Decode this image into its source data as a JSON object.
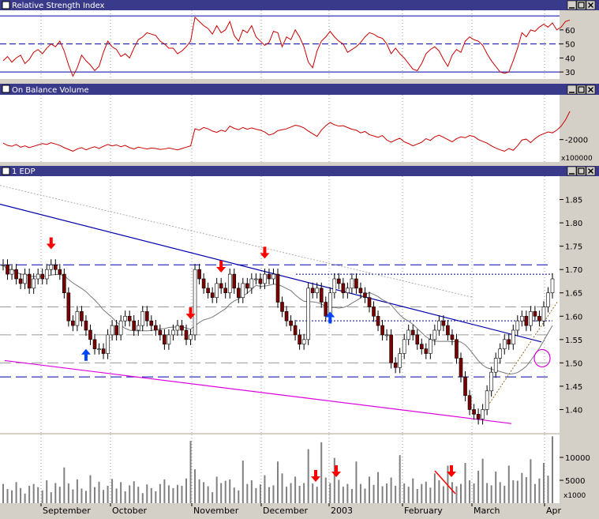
{
  "panels": {
    "rsi": {
      "title": "Relative Strength Index"
    },
    "obv": {
      "title": "On Balance Volume",
      "unit": "x100000"
    },
    "price": {
      "title": "1 EDP"
    },
    "volume": {
      "unit": "x1000"
    }
  },
  "months": [
    "September",
    "October",
    "November",
    "December",
    "2003",
    "February",
    "March",
    "Apr"
  ],
  "chart_data": [
    {
      "type": "line",
      "panel": "rsi",
      "title": "Relative Strength Index",
      "ylim": [
        25,
        74
      ],
      "yticks": [
        30,
        40,
        50,
        60
      ],
      "hlines": [
        30,
        50,
        70
      ],
      "values": [
        38,
        41,
        37,
        40,
        42,
        36,
        39,
        44,
        46,
        43,
        47,
        50,
        48,
        52,
        45,
        35,
        27,
        33,
        42,
        38,
        35,
        31,
        34,
        44,
        52,
        48,
        46,
        41,
        43,
        40,
        47,
        53,
        55,
        58,
        57,
        56,
        52,
        50,
        47,
        47,
        43,
        45,
        48,
        52,
        69,
        66,
        63,
        61,
        57,
        63,
        58,
        60,
        66,
        56,
        52,
        60,
        58,
        63,
        55,
        52,
        49,
        51,
        59,
        58,
        48,
        55,
        53,
        60,
        55,
        48,
        37,
        33,
        45,
        52,
        55,
        59,
        55,
        52,
        50,
        44,
        46,
        48,
        51,
        55,
        58,
        57,
        55,
        54,
        50,
        43,
        47,
        43,
        40,
        36,
        32,
        31,
        36,
        43,
        46,
        48,
        45,
        39,
        34,
        42,
        46,
        44,
        52,
        55,
        53,
        52,
        49,
        43,
        38,
        34,
        30,
        29,
        30,
        38,
        47,
        58,
        55,
        60,
        59,
        62,
        64,
        62,
        65,
        60,
        62,
        66,
        67
      ]
    },
    {
      "type": "line",
      "panel": "obv",
      "title": "On Balance Volume",
      "ylim": [
        -2500,
        -1000
      ],
      "yticks": [
        -2000
      ],
      "values": [
        -2080,
        -2130,
        -2150,
        -2110,
        -2170,
        -2140,
        -2180,
        -2150,
        -2120,
        -2090,
        -2110,
        -2070,
        -2100,
        -2130,
        -2180,
        -2220,
        -2260,
        -2210,
        -2180,
        -2230,
        -2190,
        -2160,
        -2200,
        -2150,
        -2110,
        -2140,
        -2120,
        -2160,
        -2130,
        -2180,
        -2210,
        -2170,
        -2190,
        -2210,
        -2190,
        -2200,
        -2220,
        -2210,
        -2190,
        -2210,
        -2230,
        -2200,
        -2170,
        -2140,
        -1760,
        -1790,
        -1730,
        -1760,
        -1810,
        -1840,
        -1790,
        -1820,
        -1700,
        -1750,
        -1780,
        -1730,
        -1770,
        -1740,
        -1770,
        -1790,
        -1830,
        -1900,
        -1870,
        -1800,
        -1780,
        -1760,
        -1720,
        -1680,
        -1700,
        -1740,
        -1810,
        -1870,
        -1930,
        -1790,
        -1690,
        -1620,
        -1670,
        -1700,
        -1690,
        -1730,
        -1770,
        -1790,
        -1850,
        -1820,
        -1890,
        -1920,
        -1950,
        -1910,
        -2010,
        -2060,
        -2010,
        -1970,
        -2050,
        -2090,
        -2140,
        -2100,
        -2060,
        -1980,
        -2020,
        -1940,
        -1900,
        -1950,
        -2000,
        -2050,
        -1980,
        -1940,
        -1960,
        -1910,
        -1930,
        -2000,
        -2040,
        -2080,
        -2140,
        -2190,
        -2230,
        -2260,
        -2200,
        -2240,
        -2140,
        -2010,
        -1990,
        -2070,
        -1980,
        -1910,
        -1870,
        -1830,
        -1850,
        -1790,
        -1700,
        -1560,
        -1370
      ]
    },
    {
      "type": "candlestick",
      "panel": "price",
      "title": "1 EDP",
      "ylim": [
        1.35,
        1.9
      ],
      "yticks": [
        1.4,
        1.45,
        1.5,
        1.55,
        1.6,
        1.65,
        1.7,
        1.75,
        1.8,
        1.85
      ],
      "close": [
        1.71,
        1.69,
        1.7,
        1.68,
        1.67,
        1.69,
        1.66,
        1.68,
        1.69,
        1.68,
        1.7,
        1.71,
        1.7,
        1.69,
        1.65,
        1.59,
        1.58,
        1.61,
        1.59,
        1.57,
        1.55,
        1.53,
        1.53,
        1.52,
        1.56,
        1.58,
        1.56,
        1.59,
        1.6,
        1.59,
        1.57,
        1.58,
        1.61,
        1.59,
        1.58,
        1.57,
        1.56,
        1.54,
        1.56,
        1.57,
        1.58,
        1.57,
        1.55,
        1.56,
        1.7,
        1.68,
        1.66,
        1.65,
        1.64,
        1.67,
        1.66,
        1.65,
        1.69,
        1.66,
        1.64,
        1.67,
        1.66,
        1.68,
        1.68,
        1.67,
        1.69,
        1.68,
        1.69,
        1.63,
        1.61,
        1.59,
        1.58,
        1.56,
        1.54,
        1.55,
        1.66,
        1.65,
        1.66,
        1.63,
        1.6,
        1.65,
        1.68,
        1.67,
        1.65,
        1.66,
        1.68,
        1.66,
        1.65,
        1.64,
        1.62,
        1.6,
        1.58,
        1.56,
        1.56,
        1.5,
        1.49,
        1.52,
        1.55,
        1.57,
        1.56,
        1.54,
        1.53,
        1.52,
        1.55,
        1.57,
        1.59,
        1.58,
        1.56,
        1.55,
        1.51,
        1.47,
        1.43,
        1.4,
        1.39,
        1.38,
        1.4,
        1.44,
        1.48,
        1.51,
        1.53,
        1.55,
        1.54,
        1.57,
        1.59,
        1.6,
        1.58,
        1.61,
        1.6,
        1.59,
        1.62,
        1.65,
        1.68
      ],
      "hlines_dashed": [
        1.71,
        1.62,
        1.56,
        1.5,
        1.47
      ],
      "hlines_dotted": [
        1.69,
        1.59
      ],
      "up_arrows_at_index": [
        19,
        75
      ],
      "down_arrows_at_index": [
        11,
        43,
        50,
        60
      ]
    },
    {
      "type": "bar",
      "panel": "volume",
      "ylim": [
        0,
        15000
      ],
      "yticks": [
        5000,
        10000
      ],
      "values": [
        4200,
        3100,
        2800,
        4600,
        3300,
        2100,
        3800,
        4200,
        3500,
        2800,
        5000,
        2400,
        4400,
        3600,
        7800,
        4300,
        3000,
        5200,
        3200,
        2700,
        6100,
        3500,
        4700,
        2900,
        3800,
        5300,
        3200,
        4600,
        2600,
        3900,
        4800,
        3600,
        2200,
        4100,
        3300,
        2600,
        4200,
        5200,
        3900,
        3300,
        4000,
        3800,
        5400,
        13600,
        7400,
        5200,
        4600,
        3700,
        2400,
        5800,
        4400,
        4900,
        5200,
        3400,
        2800,
        9300,
        4200,
        5000,
        3300,
        4100,
        6100,
        3500,
        3900,
        9100,
        6500,
        3600,
        4400,
        5800,
        3800,
        4400,
        11800,
        4300,
        3600,
        13300,
        5600,
        4400,
        9900,
        5100,
        3600,
        4200,
        3100,
        9100,
        4200,
        3200,
        5800,
        4000,
        6800,
        3700,
        4300,
        5600,
        3800,
        10500,
        4300,
        3600,
        5400,
        3100,
        4200,
        4700,
        3400,
        6500,
        5000,
        3700,
        8200,
        4600,
        3700,
        4200,
        8800,
        5000,
        4300,
        7100,
        9700,
        4400,
        3900,
        6900,
        4600,
        3800,
        8200,
        5000,
        4900,
        6600,
        5700,
        9600,
        4200,
        5400,
        8800,
        6000,
        14600
      ]
    }
  ]
}
